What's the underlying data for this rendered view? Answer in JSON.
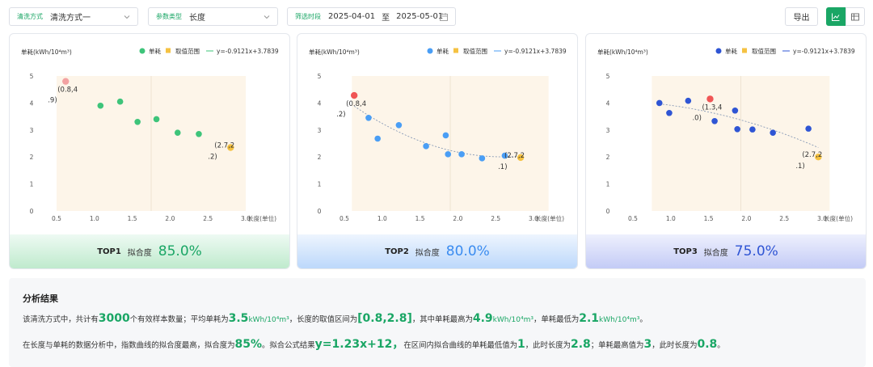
{
  "toolbar": {
    "method": {
      "label": "清洗方式",
      "value": "清洗方式一"
    },
    "param": {
      "label": "参数类型",
      "value": "长度"
    },
    "date": {
      "label": "筛选时段",
      "start": "2025-04-01",
      "sep": "至",
      "end": "2025-05-01"
    },
    "export_label": "导出"
  },
  "cards": [
    {
      "rank": "TOP1",
      "fit_label": "拟合度",
      "fit_value": "85.0%",
      "color": "#1aa665"
    },
    {
      "rank": "TOP2",
      "fit_label": "拟合度",
      "fit_value": "80.0%",
      "color": "#3b8cf0"
    },
    {
      "rank": "TOP3",
      "fit_label": "拟合度",
      "fit_value": "75.0%",
      "color": "#2f55d4"
    }
  ],
  "chart_data": [
    {
      "type": "scatter",
      "ylabel": "单耗(kWh/10⁴m³)",
      "xlabel": "长度(单位)",
      "xticks": [
        0.5,
        1.0,
        1.5,
        2.0,
        2.5,
        3.0
      ],
      "yticks": [
        0,
        1,
        2,
        3,
        4,
        5
      ],
      "xlim": [
        0.5,
        3.0
      ],
      "ylim": [
        0,
        5
      ],
      "legend": [
        "单耗",
        "取值范围",
        "y=-0.9121x+3.7839"
      ],
      "band": [
        0.5,
        3.0
      ],
      "colors": {
        "point": "#3ec47a",
        "max": "#f3a2a2",
        "min": "#f5c242",
        "fit": "#3ec47a"
      },
      "points": [
        [
          1.08,
          3.9
        ],
        [
          1.34,
          4.05
        ],
        [
          1.57,
          3.3
        ],
        [
          1.82,
          3.4
        ],
        [
          2.1,
          2.9
        ],
        [
          2.38,
          2.85
        ]
      ],
      "max_point": [
        0.62,
        4.8
      ],
      "min_point": [
        2.8,
        2.35
      ],
      "max_label": [
        "(0.8,4",
        ".9)"
      ],
      "min_label": [
        "(2.7,2",
        ".2)"
      ],
      "show_curve": false
    },
    {
      "type": "scatter",
      "ylabel": "单耗(kWh/10⁴m³)",
      "xlabel": "长度(单位)",
      "xticks": [
        0.5,
        1.0,
        1.5,
        2.0,
        2.5,
        3.0
      ],
      "yticks": [
        0,
        1,
        2,
        3,
        4,
        5
      ],
      "xlim": [
        0.5,
        3.0
      ],
      "ylim": [
        0,
        5
      ],
      "legend": [
        "单耗",
        "取值范围",
        "y=-0.9121x+3.7839"
      ],
      "band": [
        0.6,
        3.2
      ],
      "colors": {
        "point": "#4a9ef5",
        "max": "#f05555",
        "min": "#f5c242",
        "fit": "#4a9ef5"
      },
      "points": [
        [
          0.82,
          3.45
        ],
        [
          0.94,
          2.68
        ],
        [
          1.22,
          3.18
        ],
        [
          1.58,
          2.4
        ],
        [
          1.84,
          2.8
        ],
        [
          1.87,
          2.1
        ],
        [
          2.05,
          2.1
        ],
        [
          2.32,
          1.95
        ],
        [
          2.62,
          2.05
        ]
      ],
      "max_point": [
        0.63,
        4.28
      ],
      "min_point": [
        2.83,
        1.98
      ],
      "max_label": [
        "(0.8,4",
        ".2)"
      ],
      "min_label": [
        "(2.7,2",
        ".1)"
      ],
      "show_curve": true
    },
    {
      "type": "scatter",
      "ylabel": "单耗(kWh/10⁴m³)",
      "xlabel": "长度(单位)",
      "xticks": [
        0.5,
        1.0,
        1.5,
        2.0,
        2.5,
        3.0
      ],
      "yticks": [
        0,
        1,
        2,
        3,
        4,
        5
      ],
      "xlim": [
        0.5,
        3.0
      ],
      "ylim": [
        0,
        5
      ],
      "legend": [
        "单耗",
        "取值范围",
        "y=-0.9121x+3.7839"
      ],
      "band": [
        0.75,
        3.1
      ],
      "colors": {
        "point": "#2f55d4",
        "max": "#f05555",
        "min": "#f5c242",
        "fit": "#2f55d4"
      },
      "points": [
        [
          0.85,
          4.0
        ],
        [
          0.98,
          3.63
        ],
        [
          1.23,
          4.08
        ],
        [
          1.58,
          3.33
        ],
        [
          1.85,
          3.72
        ],
        [
          1.88,
          3.03
        ],
        [
          2.08,
          3.02
        ],
        [
          2.35,
          2.9
        ],
        [
          2.82,
          3.05
        ]
      ],
      "max_point": [
        1.52,
        4.15
      ],
      "min_point": [
        2.95,
        2.0
      ],
      "max_label": [
        "(1.3,4",
        ".0)"
      ],
      "min_label": [
        "(2.7,2",
        ".1)"
      ],
      "show_curve": true
    }
  ],
  "analysis": {
    "title": "分析结果",
    "l1": {
      "t1": "该清洗方式中，共计有",
      "count": "3000",
      "t2": "个有效样本数量；平均单耗为",
      "avg": "3.5",
      "unit1": "kWh/10⁴m³",
      "t3": "，长度的取值区间为",
      "range": "[0.8,2.8]",
      "t4": "，其中单耗最高为",
      "max": "4.9",
      "unit2": "kWh/10⁴m³",
      "t5": "，单耗最低为",
      "min": "2.1",
      "unit3": "kWh/10⁴m³",
      "t6": "。"
    },
    "l2": {
      "t1": "在长度与单耗的数据分析中，指数曲线的拟合度最高，拟合度为",
      "fit": "85%",
      "t2": "。拟合公式结果",
      "formula": "y=1.23x+12，",
      "t3": "在区间内拟合曲线的单耗最低值为",
      "minv": "1",
      "t4": "，此时长度为",
      "len1": "2.8",
      "t5": "；单耗最高值为",
      "maxv": "3",
      "t6": "，此时长度为",
      "len2": "0.8",
      "t7": "。"
    }
  }
}
